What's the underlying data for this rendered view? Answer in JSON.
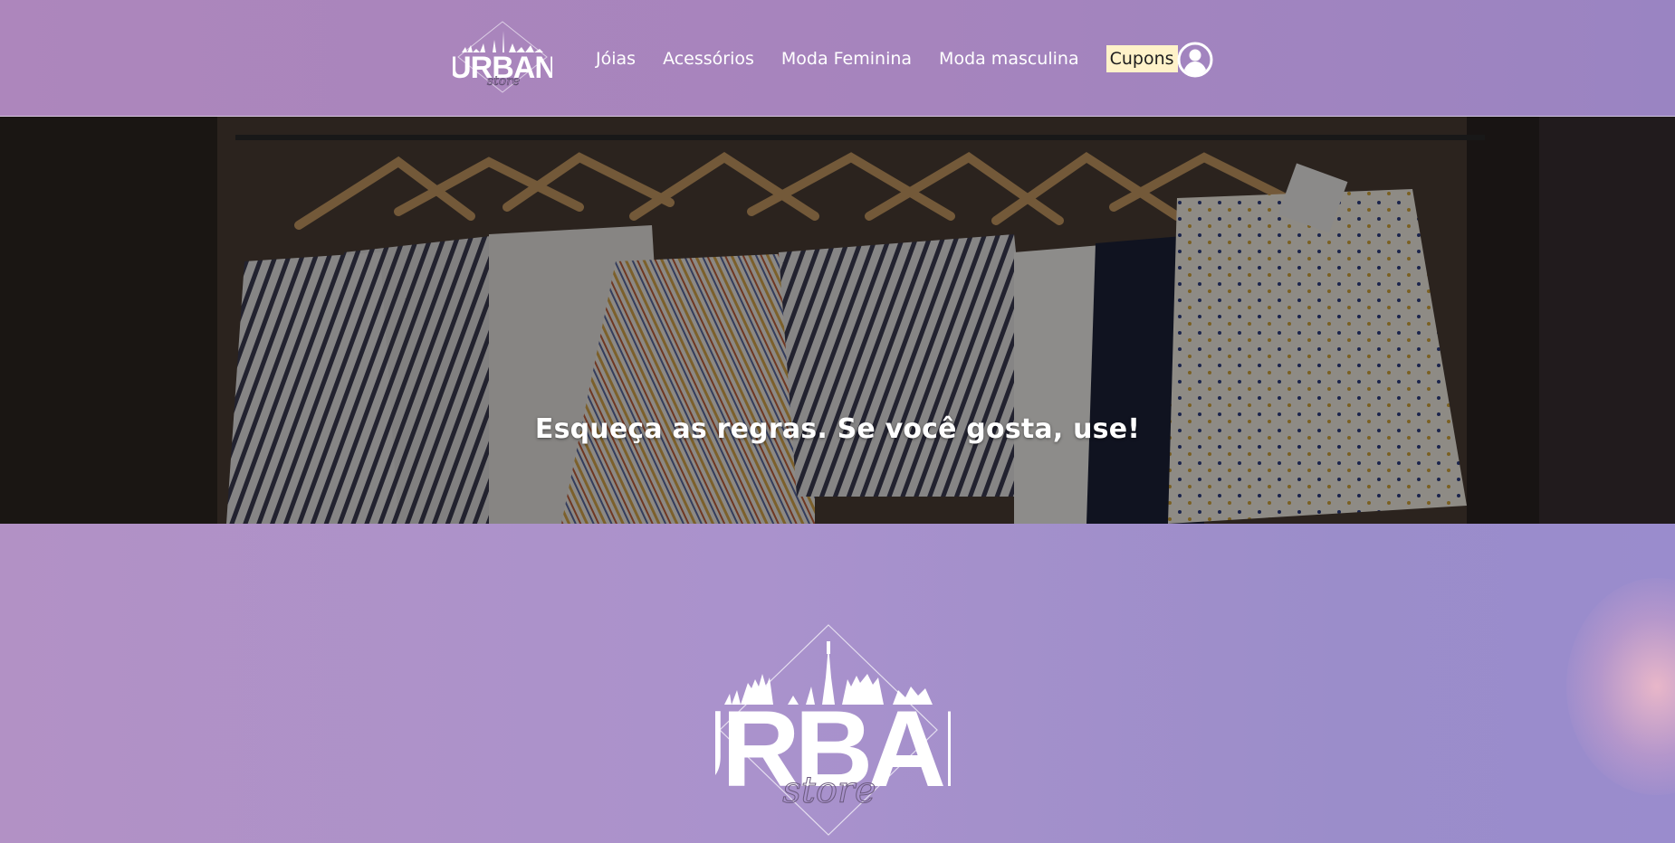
{
  "brand": {
    "name": "URBAN",
    "script_word": "store"
  },
  "nav": {
    "items": [
      {
        "label": "Jóias"
      },
      {
        "label": "Acessórios"
      },
      {
        "label": "Moda Feminina"
      },
      {
        "label": "Moda masculina"
      }
    ],
    "coupon_label": "Cupons",
    "user_icon": "user-circle-icon"
  },
  "hero": {
    "title": "Esqueça as regras. Se você gosta, use!"
  },
  "colors": {
    "header_bg": "#a684bd",
    "coupon_bg": "#fff2c9",
    "section_bg": "#aa92cc"
  }
}
